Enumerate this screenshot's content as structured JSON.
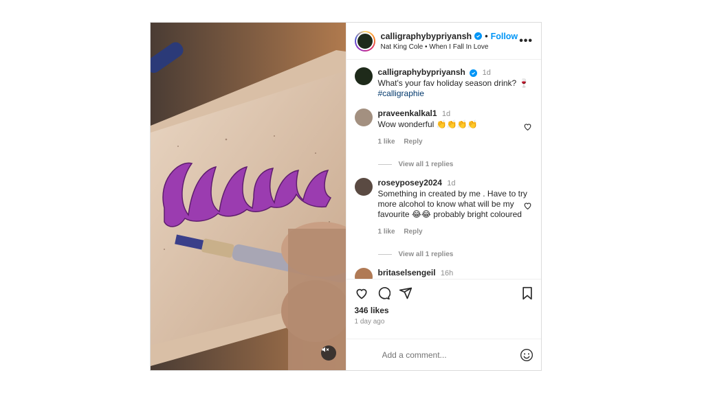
{
  "post": {
    "username": "calligraphybypriyansh",
    "follow_label": "Follow",
    "audio": "Nat King Cole • When I Fall In Love",
    "more_label": "•••"
  },
  "caption": {
    "username": "calligraphybypriyansh",
    "time": "1d",
    "text": "What's your fav holiday season drink? 🍷",
    "hashtag": "#calligraphie"
  },
  "comments": [
    {
      "username": "praveenkalkal1",
      "time": "1d",
      "text": "Wow wonderful 👏👏👏👏",
      "likes": "1 like",
      "reply": "Reply",
      "view_replies": "View all 1 replies"
    },
    {
      "username": "roseyposey2024",
      "time": "1d",
      "text": "Something in created by me . Have to try more alcohol to know what will be my favourite 😂😂 probably bright coloured",
      "likes": "1 like",
      "reply": "Reply",
      "view_replies": "View all 1 replies"
    },
    {
      "username": "britaselsengeil",
      "time": "16h"
    }
  ],
  "stats": {
    "likes": "346 likes",
    "ago": "1 day ago"
  },
  "add_comment": {
    "placeholder": "Add a comment..."
  },
  "icons": {
    "like": "heart-icon",
    "comment": "comment-icon",
    "share": "share-icon",
    "save": "bookmark-icon",
    "emoji": "emoji-icon",
    "mute": "muted-speaker-icon",
    "verified": "verified-badge-icon"
  },
  "colors": {
    "link_blue": "#0095f6",
    "hashtag": "#00376b",
    "muted_text": "#8e8e8e",
    "ink_purple": "#8a2fa0"
  }
}
